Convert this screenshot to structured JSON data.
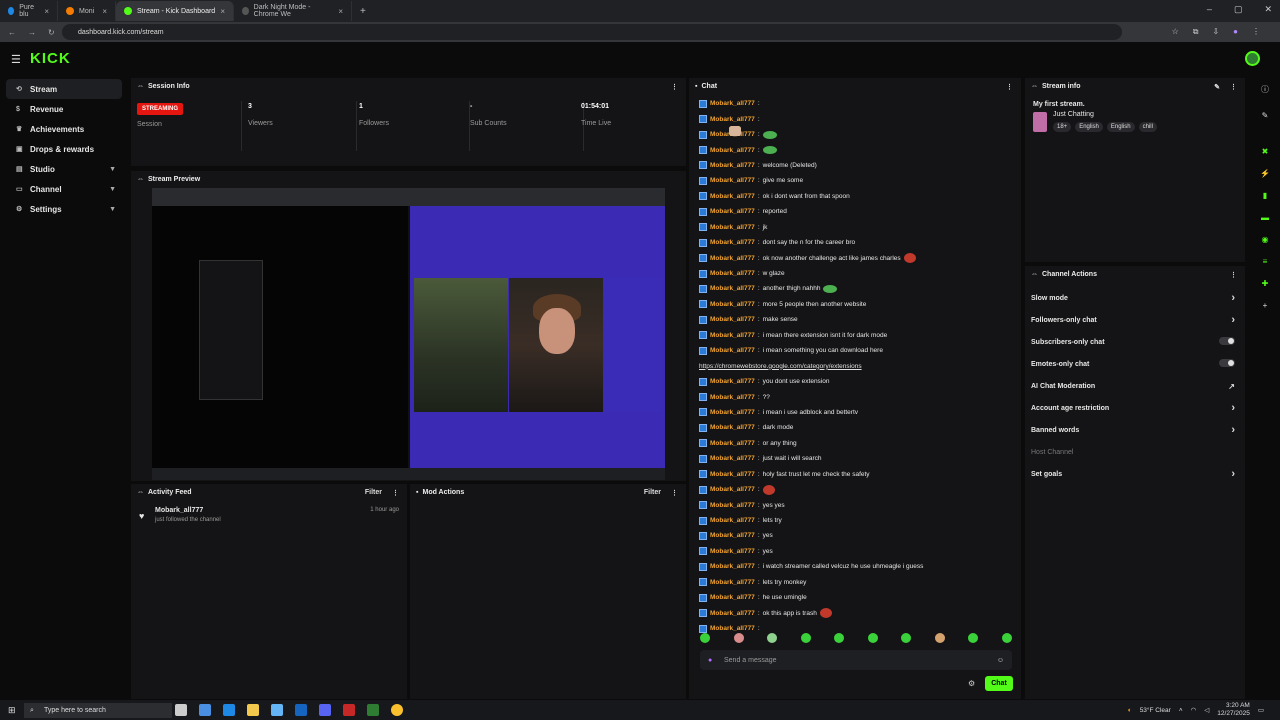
{
  "browser": {
    "tabs": [
      {
        "label": "Pure blu",
        "active": false
      },
      {
        "label": "Moni",
        "active": false
      },
      {
        "label": "Stream - Kick Dashboard",
        "active": true
      },
      {
        "label": "Dark Night Mode - Chrome We",
        "active": false
      }
    ],
    "url": "dashboard.kick.com/stream"
  },
  "app": {
    "logo": "KICK",
    "accent": "#53fc18"
  },
  "sidebar": {
    "items": [
      {
        "label": "Stream",
        "icon": "stream-icon",
        "active": true
      },
      {
        "label": "Revenue",
        "icon": "dollar-icon"
      },
      {
        "label": "Achievements",
        "icon": "trophy-icon"
      },
      {
        "label": "Drops & rewards",
        "icon": "gift-icon"
      },
      {
        "label": "Studio",
        "icon": "studio-icon",
        "chevron": true
      },
      {
        "label": "Channel",
        "icon": "channel-icon",
        "chevron": true
      },
      {
        "label": "Settings",
        "icon": "gear-icon",
        "chevron": true
      }
    ]
  },
  "session": {
    "title": "Session Info",
    "status": "STREAMING",
    "session_label": "Session",
    "viewers": "3",
    "viewers_label": "Viewers",
    "followers": "1",
    "followers_label": "Followers",
    "subs": "-",
    "subs_label": "Sub Counts",
    "time": "01:54:01",
    "time_label": "Time Live"
  },
  "preview": {
    "title": "Stream Preview"
  },
  "activity": {
    "title": "Activity Feed",
    "filter": "Filter",
    "items": [
      {
        "user": "Mobark_all777",
        "text": "just followed the channel",
        "time": "1 hour ago"
      }
    ]
  },
  "mod": {
    "title": "Mod Actions",
    "filter": "Filter"
  },
  "chat": {
    "title": "Chat",
    "placeholder": "Send a message",
    "send": "Chat",
    "messages": [
      {
        "user": "Mobark_all777",
        "text": "",
        "emote": "face"
      },
      {
        "user": "Mobark_all777",
        "text": "",
        "emote": "face"
      },
      {
        "user": "Mobark_all777",
        "text": "",
        "emote": "green"
      },
      {
        "user": "Mobark_all777",
        "text": "",
        "emote": "green"
      },
      {
        "user": "Mobark_all777",
        "text": "welcome (Deleted)",
        "emote": ""
      },
      {
        "user": "Mobark_all777",
        "text": "give me some",
        "emote": ""
      },
      {
        "user": "Mobark_all777",
        "text": "ok i dont want from that spoon",
        "emote": "face"
      },
      {
        "user": "Mobark_all777",
        "text": "reported",
        "emote": "face"
      },
      {
        "user": "Mobark_all777",
        "text": "jk",
        "emote": ""
      },
      {
        "user": "Mobark_all777",
        "text": "dont say the n for the career bro",
        "emote": ""
      },
      {
        "user": "Mobark_all777",
        "text": "ok now another challenge act like james charles",
        "emote": "red"
      },
      {
        "user": "Mobark_all777",
        "text": "w glaze",
        "emote": ""
      },
      {
        "user": "Mobark_all777",
        "text": "another thigh nahhh",
        "emote": "green"
      },
      {
        "user": "Mobark_all777",
        "text": "more 5 people then another website",
        "emote": ""
      },
      {
        "user": "Mobark_all777",
        "text": "make sense",
        "emote": ""
      },
      {
        "user": "Mobark_all777",
        "text": "i mean there extension isnt it for dark mode",
        "emote": ""
      },
      {
        "user": "Mobark_all777",
        "text": "i mean something you can download here",
        "emote": ""
      },
      {
        "user": "",
        "text": "https://chromewebstore.google.com/category/extensions",
        "emote": ""
      },
      {
        "user": "Mobark_all777",
        "text": "you dont use extension",
        "emote": ""
      },
      {
        "user": "Mobark_all777",
        "text": "??",
        "emote": ""
      },
      {
        "user": "Mobark_all777",
        "text": "i mean i use adblock and bettertv",
        "emote": ""
      },
      {
        "user": "Mobark_all777",
        "text": "dark mode",
        "emote": ""
      },
      {
        "user": "Mobark_all777",
        "text": "or any thing",
        "emote": ""
      },
      {
        "user": "Mobark_all777",
        "text": "just wait i will search",
        "emote": ""
      },
      {
        "user": "Mobark_all777",
        "text": "holy fast trust let me check the safety",
        "emote": ""
      },
      {
        "user": "Mobark_all777",
        "text": "",
        "emote": "red"
      },
      {
        "user": "Mobark_all777",
        "text": "yes yes",
        "emote": ""
      },
      {
        "user": "Mobark_all777",
        "text": "lets try",
        "emote": ""
      },
      {
        "user": "Mobark_all777",
        "text": "yes",
        "emote": ""
      },
      {
        "user": "Mobark_all777",
        "text": "yes",
        "emote": ""
      },
      {
        "user": "Mobark_all777",
        "text": "i watch streamer called velcuz he use uhmeagle i guess",
        "emote": ""
      },
      {
        "user": "Mobark_all777",
        "text": "lets try monkey",
        "emote": ""
      },
      {
        "user": "Mobark_all777",
        "text": "he use umingle",
        "emote": ""
      },
      {
        "user": "Mobark_all777",
        "text": "ok this app is trash",
        "emote": "red"
      },
      {
        "user": "Mobark_all777",
        "text": "",
        "emote": "face"
      }
    ]
  },
  "stream_info": {
    "title": "Stream info",
    "stream_title": "My first stream.",
    "category": "Just Chatting",
    "tags": [
      "18+",
      "English",
      "English",
      "chill"
    ]
  },
  "channel_actions": {
    "title": "Channel Actions",
    "items": [
      {
        "label": "Slow mode",
        "control": "arrow"
      },
      {
        "label": "Followers-only chat",
        "control": "arrow"
      },
      {
        "label": "Subscribers-only chat",
        "control": "toggle"
      },
      {
        "label": "Emotes-only chat",
        "control": "toggle"
      },
      {
        "label": "AI Chat Moderation",
        "control": "external"
      },
      {
        "label": "Account age restriction",
        "control": "arrow"
      },
      {
        "label": "Banned words",
        "control": "arrow"
      },
      {
        "label": "Host Channel",
        "control": "none",
        "disabled": true
      },
      {
        "label": "Set goals",
        "control": "arrow"
      }
    ]
  },
  "taskbar": {
    "search": "Type here to search",
    "weather": "53°F  Clear",
    "time": "3:20 AM",
    "date": "12/27/2025"
  }
}
